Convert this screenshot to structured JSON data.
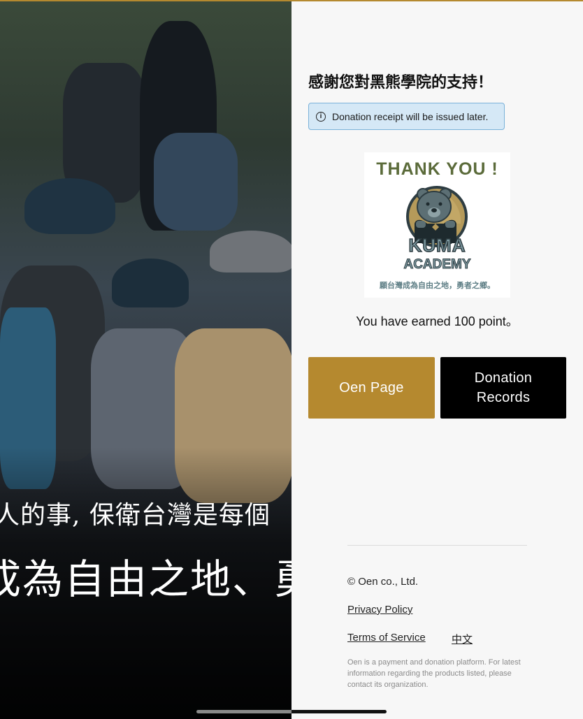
{
  "hero": {
    "overlay_line1": "人的事, 保衛台灣是每個",
    "overlay_line2": "成為自由之地、勇"
  },
  "panel": {
    "heading": "感謝您對黑熊學院的支持！",
    "alert": {
      "icon": "info-icon",
      "text": "Donation receipt will be issued later."
    },
    "thank_card": {
      "title": "THANK YOU !",
      "logo_line1": "KUMA",
      "logo_line2": "ACADEMY",
      "slogan": "願台灣成為自由之地，勇者之鄉。"
    },
    "points_text": "You have earned  100  point。",
    "buttons": {
      "oen_page": "Oen Page",
      "donation_records_line1": "Donation",
      "donation_records_line2": "Records"
    }
  },
  "footer": {
    "copyright": "© Oen co., Ltd.",
    "privacy_policy": "Privacy Policy",
    "terms_of_service": "Terms of Service",
    "language": "中文",
    "disclaimer": "Oen is a payment and donation platform. For latest information regarding the products listed, please contact its organization."
  },
  "colors": {
    "accent_gold": "#b5892f",
    "button_black": "#000000",
    "alert_bg": "#d5e8f6",
    "alert_border": "#7ab2d9"
  }
}
